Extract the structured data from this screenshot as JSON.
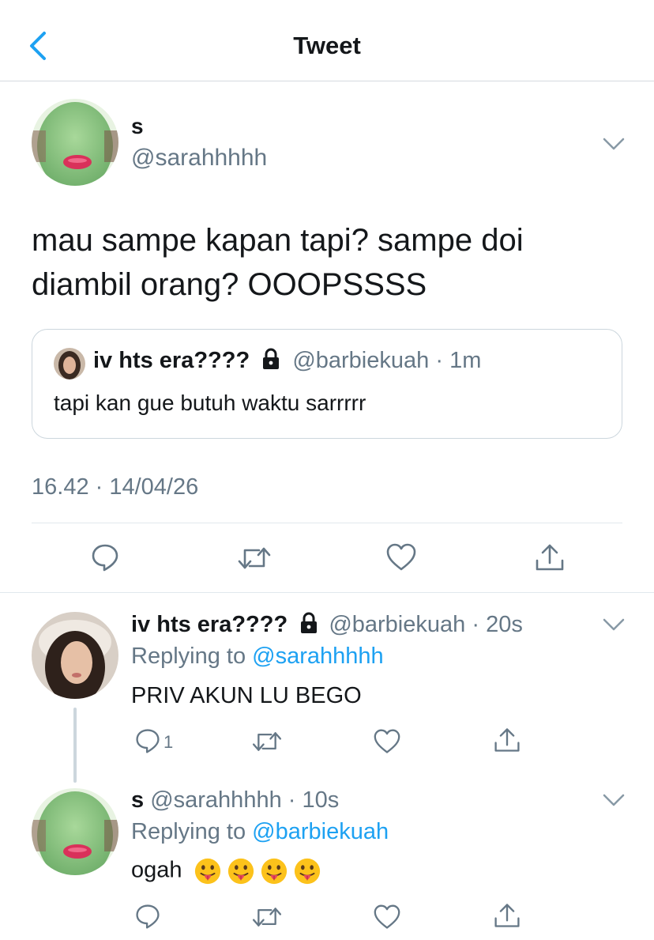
{
  "header": {
    "title": "Tweet"
  },
  "main_tweet": {
    "display_name": "s",
    "handle": "@sarahhhhh",
    "text_line1": "mau sampe kapan tapi? sampe doi",
    "text_line2": "diambil orang? OOOPSSSS",
    "quote": {
      "display_name": "iv hts era????",
      "handle": "@barbiekuah",
      "separator": "·",
      "time": "1m",
      "text": "tapi kan gue butuh waktu sarrrrr"
    },
    "timestamp": "16.42 · 14/04/26"
  },
  "replies": [
    {
      "display_name": "iv hts era????",
      "handle": "@barbiekuah",
      "separator": "·",
      "time": "20s",
      "replying_prefix": "Replying to",
      "replying_to": "@sarahhhhh",
      "text": "PRIV AKUN LU BEGO",
      "reply_count": "1"
    },
    {
      "display_name": "s",
      "handle": "@sarahhhhh",
      "separator": "·",
      "time": "10s",
      "replying_prefix": "Replying to",
      "replying_to": "@barbiekuah",
      "text": "ogah",
      "emojis": [
        "tongue-face",
        "tongue-face",
        "tongue-face",
        "tongue-face"
      ]
    }
  ],
  "icons": {
    "back": "chevron-left-icon",
    "more": "chevron-down-icon",
    "reply": "comment-icon",
    "retweet": "retweet-icon",
    "like": "heart-icon",
    "share": "share-icon",
    "lock": "lock-icon"
  },
  "colors": {
    "accent": "#1da1f2",
    "secondary_text": "#657786",
    "primary_text": "#14171a",
    "border": "#e1e8ed"
  }
}
